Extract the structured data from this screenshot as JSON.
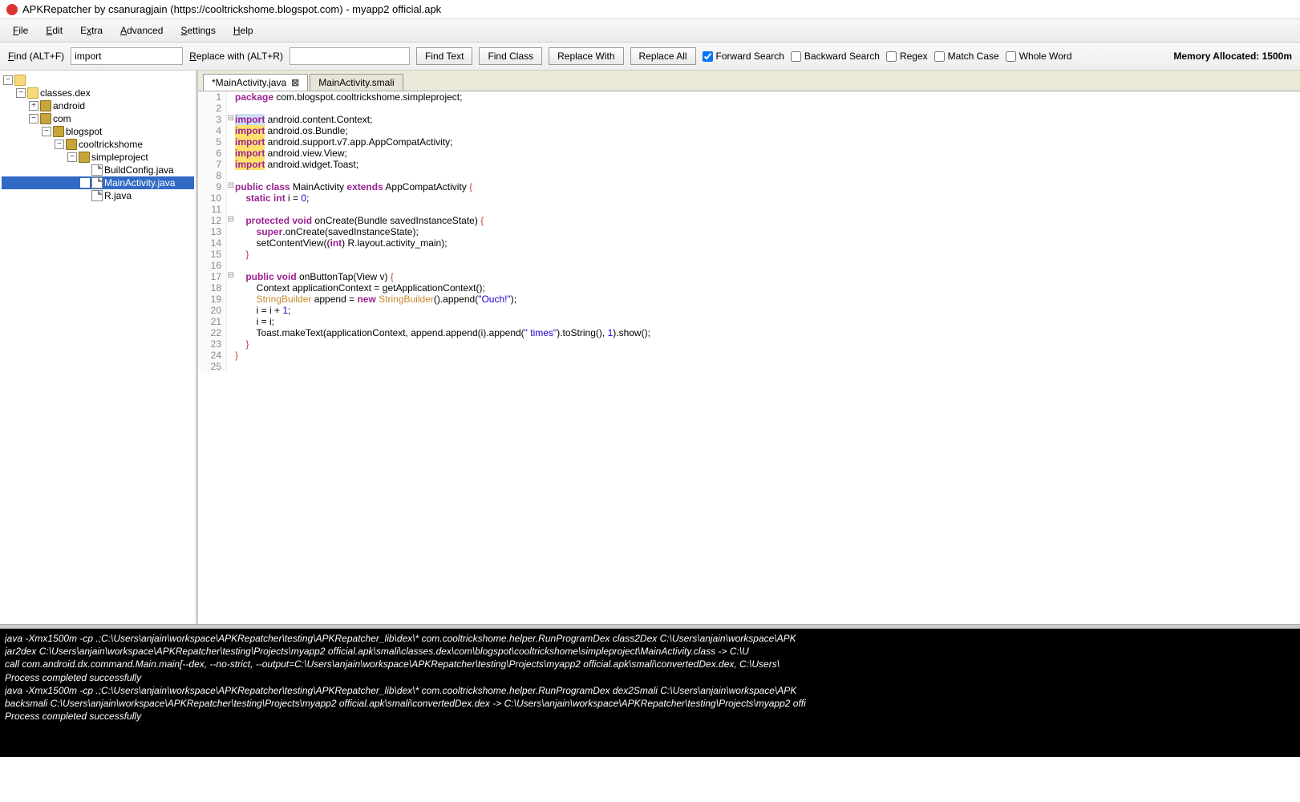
{
  "title": "APKRepatcher by csanuragjain (https://cooltrickshome.blogspot.com) - myapp2 official.apk",
  "menubar": [
    {
      "label": "File",
      "u": "F"
    },
    {
      "label": "Edit",
      "u": "E"
    },
    {
      "label": "Extra",
      "u": "x"
    },
    {
      "label": "Advanced",
      "u": "A"
    },
    {
      "label": "Settings",
      "u": "S"
    },
    {
      "label": "Help",
      "u": "H"
    }
  ],
  "toolbar": {
    "find_label": "Find (ALT+F)",
    "find_value": "import",
    "replace_label": "Replace with (ALT+R)",
    "replace_value": "",
    "btn_find_text": "Find Text",
    "btn_find_class": "Find Class",
    "btn_replace_with": "Replace With",
    "btn_replace_all": "Replace All",
    "chk_forward": "Forward Search",
    "chk_forward_checked": true,
    "chk_backward": "Backward Search",
    "chk_backward_checked": false,
    "chk_regex": "Regex",
    "chk_regex_checked": false,
    "chk_matchcase": "Match Case",
    "chk_matchcase_checked": false,
    "chk_wholeword": "Whole Word",
    "chk_wholeword_checked": false,
    "mem": "Memory Allocated: 1500m"
  },
  "tree": {
    "root": "",
    "items": [
      {
        "depth": 0,
        "toggle": "−",
        "icon": "folder-open",
        "label": ""
      },
      {
        "depth": 1,
        "toggle": "−",
        "icon": "folder-open",
        "label": "classes.dex"
      },
      {
        "depth": 2,
        "toggle": "+",
        "icon": "package",
        "label": "android"
      },
      {
        "depth": 2,
        "toggle": "−",
        "icon": "package",
        "label": "com"
      },
      {
        "depth": 3,
        "toggle": "−",
        "icon": "package",
        "label": "blogspot"
      },
      {
        "depth": 4,
        "toggle": "−",
        "icon": "package",
        "label": "cooltrickshome"
      },
      {
        "depth": 5,
        "toggle": "−",
        "icon": "package",
        "label": "simpleproject"
      },
      {
        "depth": 6,
        "toggle": " ",
        "icon": "file",
        "label": "BuildConfig.java"
      },
      {
        "depth": 6,
        "toggle": " ",
        "icon": "file",
        "label": "MainActivity.java",
        "selected": true
      },
      {
        "depth": 6,
        "toggle": " ",
        "icon": "file",
        "label": "R.java"
      }
    ]
  },
  "tabs": [
    {
      "label": "*MainActivity.java",
      "active": true,
      "close": true
    },
    {
      "label": "MainActivity.smali",
      "active": false,
      "close": false
    }
  ],
  "code": [
    {
      "n": 1,
      "fold": "",
      "html": "<span class='kw'>package</span> com.blogspot.cooltrickshome.simpleproject;"
    },
    {
      "n": 2,
      "fold": "",
      "html": ""
    },
    {
      "n": 3,
      "fold": "⊟",
      "html": "<span class='kw sel'>import</span> android.content.Context;"
    },
    {
      "n": 4,
      "fold": "",
      "html": "<span class='hl'>import</span> android.os.Bundle;"
    },
    {
      "n": 5,
      "fold": "",
      "html": "<span class='hl'>import</span> android.support.v7.app.AppCompatActivity;"
    },
    {
      "n": 6,
      "fold": "",
      "html": "<span class='hl'>import</span> android.view.View;"
    },
    {
      "n": 7,
      "fold": "",
      "html": "<span class='hl'>import</span> android.widget.Toast;"
    },
    {
      "n": 8,
      "fold": "",
      "html": ""
    },
    {
      "n": 9,
      "fold": "⊟",
      "html": "<span class='kw'>public class</span> MainActivity <span class='kw'>extends</span> AppCompatActivity <span class='brace'>{</span>"
    },
    {
      "n": 10,
      "fold": "",
      "html": "    <span class='kw'>static int</span> i = <span class='num'>0</span>;"
    },
    {
      "n": 11,
      "fold": "",
      "html": ""
    },
    {
      "n": 12,
      "fold": "⊟",
      "html": "    <span class='kw'>protected void</span> onCreate(Bundle savedInstanceState) <span class='brace'>{</span>"
    },
    {
      "n": 13,
      "fold": "",
      "html": "        <span class='kw'>super</span>.onCreate(savedInstanceState);"
    },
    {
      "n": 14,
      "fold": "",
      "html": "        setContentView((<span class='kw'>int</span>) R.layout.activity_main);"
    },
    {
      "n": 15,
      "fold": "",
      "html": "    <span class='brace'>}</span>"
    },
    {
      "n": 16,
      "fold": "",
      "html": ""
    },
    {
      "n": 17,
      "fold": "⊟",
      "html": "    <span class='kw'>public void</span> onButtonTap(View v) <span class='brace'>{</span>"
    },
    {
      "n": 18,
      "fold": "",
      "html": "        Context applicationContext = getApplicationContext();"
    },
    {
      "n": 19,
      "fold": "",
      "html": "        <span class='cls'>StringBuilder</span> append = <span class='kw'>new</span> <span class='cls'>StringBuilder</span>().append(<span class='str'>\"Ouch!\"</span>);"
    },
    {
      "n": 20,
      "fold": "",
      "html": "        i = i + <span class='num'>1</span>;"
    },
    {
      "n": 21,
      "fold": "",
      "html": "        i = i;"
    },
    {
      "n": 22,
      "fold": "",
      "html": "        Toast.makeText(applicationContext, append.append(i).append(<span class='str'>\" times\"</span>).toString(), <span class='num'>1</span>).show();"
    },
    {
      "n": 23,
      "fold": "",
      "html": "    <span class='brace'>}</span>"
    },
    {
      "n": 24,
      "fold": "",
      "html": "<span class='brace'>}</span>"
    },
    {
      "n": 25,
      "fold": "",
      "html": ""
    }
  ],
  "console": [
    "java -Xmx1500m -cp .;C:\\Users\\anjain\\workspace\\APKRepatcher\\testing\\APKRepatcher_lib\\dex\\* com.cooltrickshome.helper.RunProgramDex class2Dex C:\\Users\\anjain\\workspace\\APK",
    "jar2dex C:\\Users\\anjain\\workspace\\APKRepatcher\\testing\\Projects\\myapp2 official.apk\\smali\\classes.dex\\com\\blogspot\\cooltrickshome\\simpleproject\\MainActivity.class -> C:\\U",
    "call com.android.dx.command.Main.main[--dex, --no-strict, --output=C:\\Users\\anjain\\workspace\\APKRepatcher\\testing\\Projects\\myapp2 official.apk\\smali\\convertedDex.dex, C:\\Users\\",
    "Process completed successfully",
    "java -Xmx1500m -cp .;C:\\Users\\anjain\\workspace\\APKRepatcher\\testing\\APKRepatcher_lib\\dex\\* com.cooltrickshome.helper.RunProgramDex dex2Smali C:\\Users\\anjain\\workspace\\APK",
    "backsmali C:\\Users\\anjain\\workspace\\APKRepatcher\\testing\\Projects\\myapp2 official.apk\\smali\\convertedDex.dex -> C:\\Users\\anjain\\workspace\\APKRepatcher\\testing\\Projects\\myapp2 offi",
    "Process completed successfully"
  ]
}
